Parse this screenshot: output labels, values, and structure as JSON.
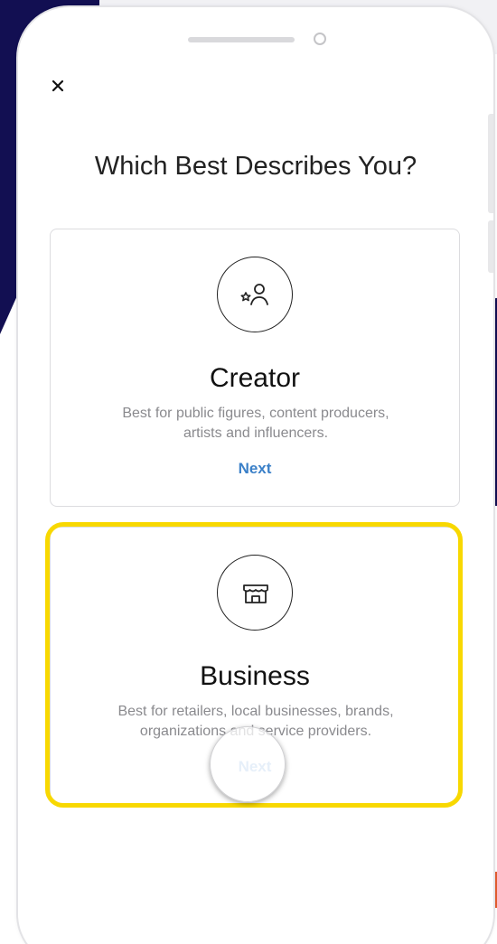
{
  "screen": {
    "title": "Which Best Describes You?",
    "close_icon": "close-icon"
  },
  "cards": [
    {
      "title": "Creator",
      "description_line1": "Best for public figures, content producers,",
      "description_line2": "artists and influencers.",
      "action": "Next",
      "icon": "creator-icon"
    },
    {
      "title": "Business",
      "description_line1": "Best for retailers, local businesses, brands,",
      "description_line2": "organizations and service providers.",
      "action": "Next",
      "icon": "store-icon",
      "highlighted": true
    }
  ],
  "colors": {
    "accent_link": "#3b80c8",
    "highlight": "#f8d800",
    "background_navy": "#120f52",
    "background_orange": "#e25b2e"
  }
}
